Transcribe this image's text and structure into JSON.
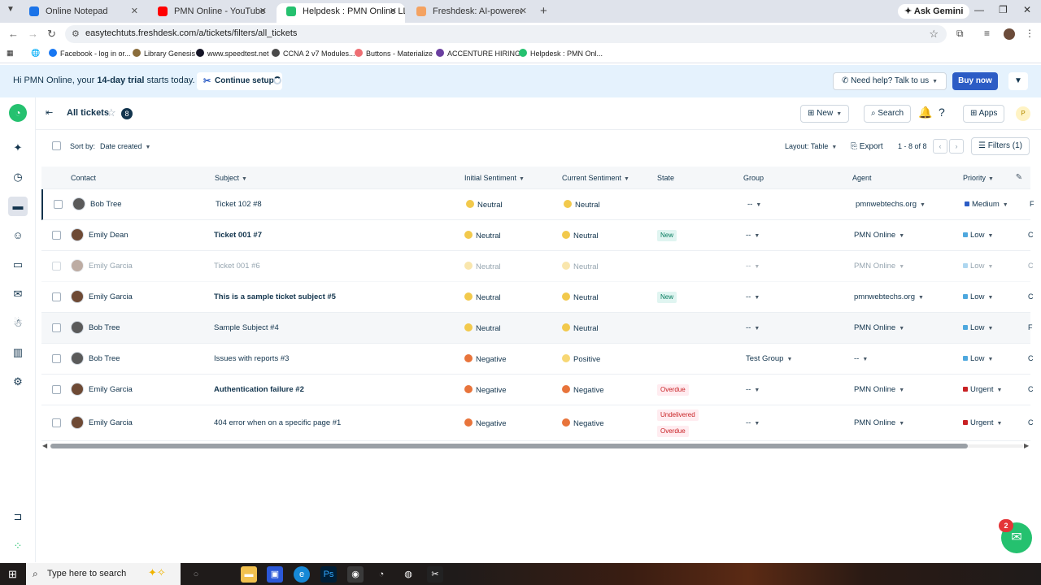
{
  "browser": {
    "tabs": [
      {
        "label": "Online Notepad",
        "fav_color": "#1a73e8"
      },
      {
        "label": "PMN Online - YouTube",
        "fav_color": "#ff0000"
      },
      {
        "label": "Helpdesk : PMN Online LLC",
        "fav_color": "#25c16f"
      },
      {
        "label": "Freshdesk: AI-powered platform",
        "fav_color": "#f4a261"
      }
    ],
    "ask_gemini": "Ask Gemini",
    "url": "easytechtuts.freshdesk.com/a/tickets/filters/all_tickets",
    "bookmarks": [
      {
        "label": "Facebook - log in or...",
        "color": "#1877f2"
      },
      {
        "label": "Library Genesis",
        "color": "#8a6d3b"
      },
      {
        "label": "www.speedtest.net",
        "color": "#141526"
      },
      {
        "label": "CCNA 2 v7 Modules...",
        "color": "#4a4a4a"
      },
      {
        "label": "Buttons - Materialize",
        "color": "#ee6e73"
      },
      {
        "label": "ACCENTURE HIRING!!",
        "color": "#6a3fa0"
      },
      {
        "label": "Helpdesk : PMN Onl...",
        "color": "#25c16f"
      }
    ]
  },
  "banner": {
    "prefix": "Hi PMN Online, your ",
    "trial": "14-day trial",
    "suffix": " starts today.",
    "continue_setup": "Continue setup",
    "need_help": "Need help? Talk to us",
    "buy_now": "Buy now"
  },
  "header": {
    "title": "All tickets",
    "count": "8",
    "new_label": "New",
    "search_label": "Search",
    "apps_label": "Apps",
    "avatar_initial": "P"
  },
  "toolbar": {
    "sort_by": "Sort by:",
    "sort_value": "Date created",
    "layout": "Layout: Table",
    "export": "Export",
    "pagination": "1 - 8 of 8",
    "filters": "Filters (1)"
  },
  "table": {
    "columns": [
      "Contact",
      "Subject",
      "Initial Sentiment",
      "Current Sentiment",
      "State",
      "Group",
      "Agent",
      "Priority"
    ],
    "rows": [
      {
        "contact": "Bob Tree",
        "subject": "Ticket 102 #8",
        "initial": "Neutral",
        "current": "Neutral",
        "state": "",
        "state2": "",
        "group": "--",
        "agent": "pmnwebtechs.org",
        "priority": "Medium",
        "priority_color": "#2c5cc5",
        "truncated": "F"
      },
      {
        "contact": "Emily Dean",
        "subject": "Ticket 001 #7",
        "initial": "Neutral",
        "current": "Neutral",
        "state": "New",
        "state2": "",
        "group": "--",
        "agent": "PMN Online",
        "priority": "Low",
        "priority_color": "#4ea8de",
        "truncated": "C"
      },
      {
        "contact": "Emily Garcia",
        "subject": "Ticket 001 #6",
        "initial": "Neutral",
        "current": "Neutral",
        "state": "",
        "state2": "",
        "group": "--",
        "agent": "PMN Online",
        "priority": "Low",
        "priority_color": "#4ea8de",
        "truncated": "C"
      },
      {
        "contact": "Emily Garcia",
        "subject": "This is a sample ticket subject #5",
        "initial": "Neutral",
        "current": "Neutral",
        "state": "New",
        "state2": "",
        "group": "--",
        "agent": "pmnwebtechs.org",
        "priority": "Low",
        "priority_color": "#4ea8de",
        "truncated": "C"
      },
      {
        "contact": "Bob Tree",
        "subject": "Sample Subject #4",
        "initial": "Neutral",
        "current": "Neutral",
        "state": "",
        "state2": "",
        "group": "--",
        "agent": "PMN Online",
        "priority": "Low",
        "priority_color": "#4ea8de",
        "truncated": "F"
      },
      {
        "contact": "Bob Tree",
        "subject": "Issues with reports #3",
        "initial": "Negative",
        "current": "Positive",
        "state": "",
        "state2": "",
        "group": "Test Group",
        "agent": "--",
        "priority": "Low",
        "priority_color": "#4ea8de",
        "truncated": "C"
      },
      {
        "contact": "Emily Garcia",
        "subject": "Authentication failure #2",
        "initial": "Negative",
        "current": "Negative",
        "state": "Overdue",
        "state2": "",
        "group": "--",
        "agent": "PMN Online",
        "priority": "Urgent",
        "priority_color": "#c82124",
        "truncated": "C"
      },
      {
        "contact": "Emily Garcia",
        "subject": "404 error when on a specific page #1",
        "initial": "Negative",
        "current": "Negative",
        "state": "Undelivered",
        "state2": "Overdue",
        "group": "--",
        "agent": "PMN Online",
        "priority": "Urgent",
        "priority_color": "#c82124",
        "truncated": "C"
      }
    ]
  },
  "chat_badge": "2",
  "taskbar": {
    "search_placeholder": "Type here to search"
  }
}
